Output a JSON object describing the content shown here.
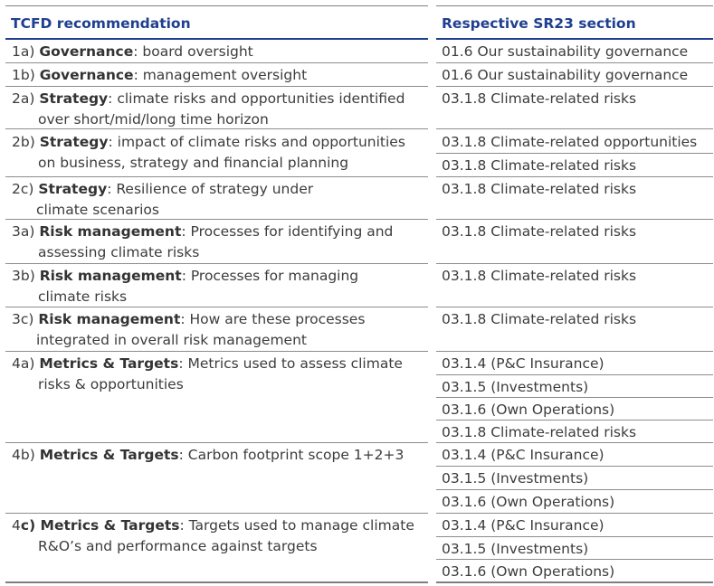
{
  "header": {
    "left": "TCFD recommendation",
    "right": "Respective SR23 section"
  },
  "rows": [
    {
      "code": "1a)",
      "bold": "Governance",
      "rest": ": board oversight",
      "line2": ""
    },
    {
      "code": "1b)",
      "bold": "Governance",
      "rest": ": management oversight",
      "line2": ""
    },
    {
      "code": "2a)",
      "bold": "Strategy",
      "rest": ": climate risks and opportunities identified",
      "line2": "over short/mid/long time horizon"
    },
    {
      "code": "2b)",
      "bold": "Strategy",
      "rest": ": impact of climate risks and opportunities",
      "line2": "on business, strategy and financial planning"
    },
    {
      "code": "2c)",
      "bold": "Strategy",
      "rest": ": Resilience of strategy under",
      "line2": "climate scenarios"
    },
    {
      "code": "3a)",
      "bold": "Risk management",
      "rest": ": Processes for identifying and",
      "line2": "assessing climate risks"
    },
    {
      "code": "3b)",
      "bold": "Risk management",
      "rest": ": Processes for managing",
      "line2": "climate risks"
    },
    {
      "code": "3c)",
      "bold": "Risk management",
      "rest": ": How are these processes",
      "line2": "integrated in overall risk management"
    },
    {
      "code": "4a)",
      "bold": "Metrics & Targets",
      "rest": ": Metrics used to assess climate",
      "line2": "risks & opportunities"
    },
    {
      "code": "4b)",
      "bold": "Metrics & Targets",
      "rest": ": Carbon footprint scope 1+2+3",
      "line2": ""
    },
    {
      "code": "4",
      "bold": "c) Metrics & Targets",
      "rest": ": Targets used to manage climate",
      "line2": "R&O’s and performance against targets"
    }
  ],
  "sections": [
    "01.6 Our sustainability governance",
    "01.6 Our sustainability governance",
    "03.1.8 Climate-related risks",
    "03.1.8 Climate-related opportunities",
    "03.1.8 Climate-related risks",
    "03.1.8 Climate-related risks",
    "03.1.8 Climate-related risks",
    "03.1.8 Climate-related risks",
    "03.1.8 Climate-related risks",
    "03.1.4 (P&C Insurance)",
    "03.1.5 (Investments)",
    "03.1.6 (Own Operations)",
    "03.1.8 Climate-related risks",
    "03.1.4 (P&C Insurance)",
    "03.1.5 (Investments)",
    "03.1.6 (Own Operations)",
    "03.1.4 (P&C Insurance)",
    "03.1.5 (Investments)",
    "03.1.6 (Own Operations)"
  ],
  "colors": {
    "header_text": "#1f3f8f",
    "body_text": "#3c3c3c",
    "rule": "#8c8c8c"
  }
}
